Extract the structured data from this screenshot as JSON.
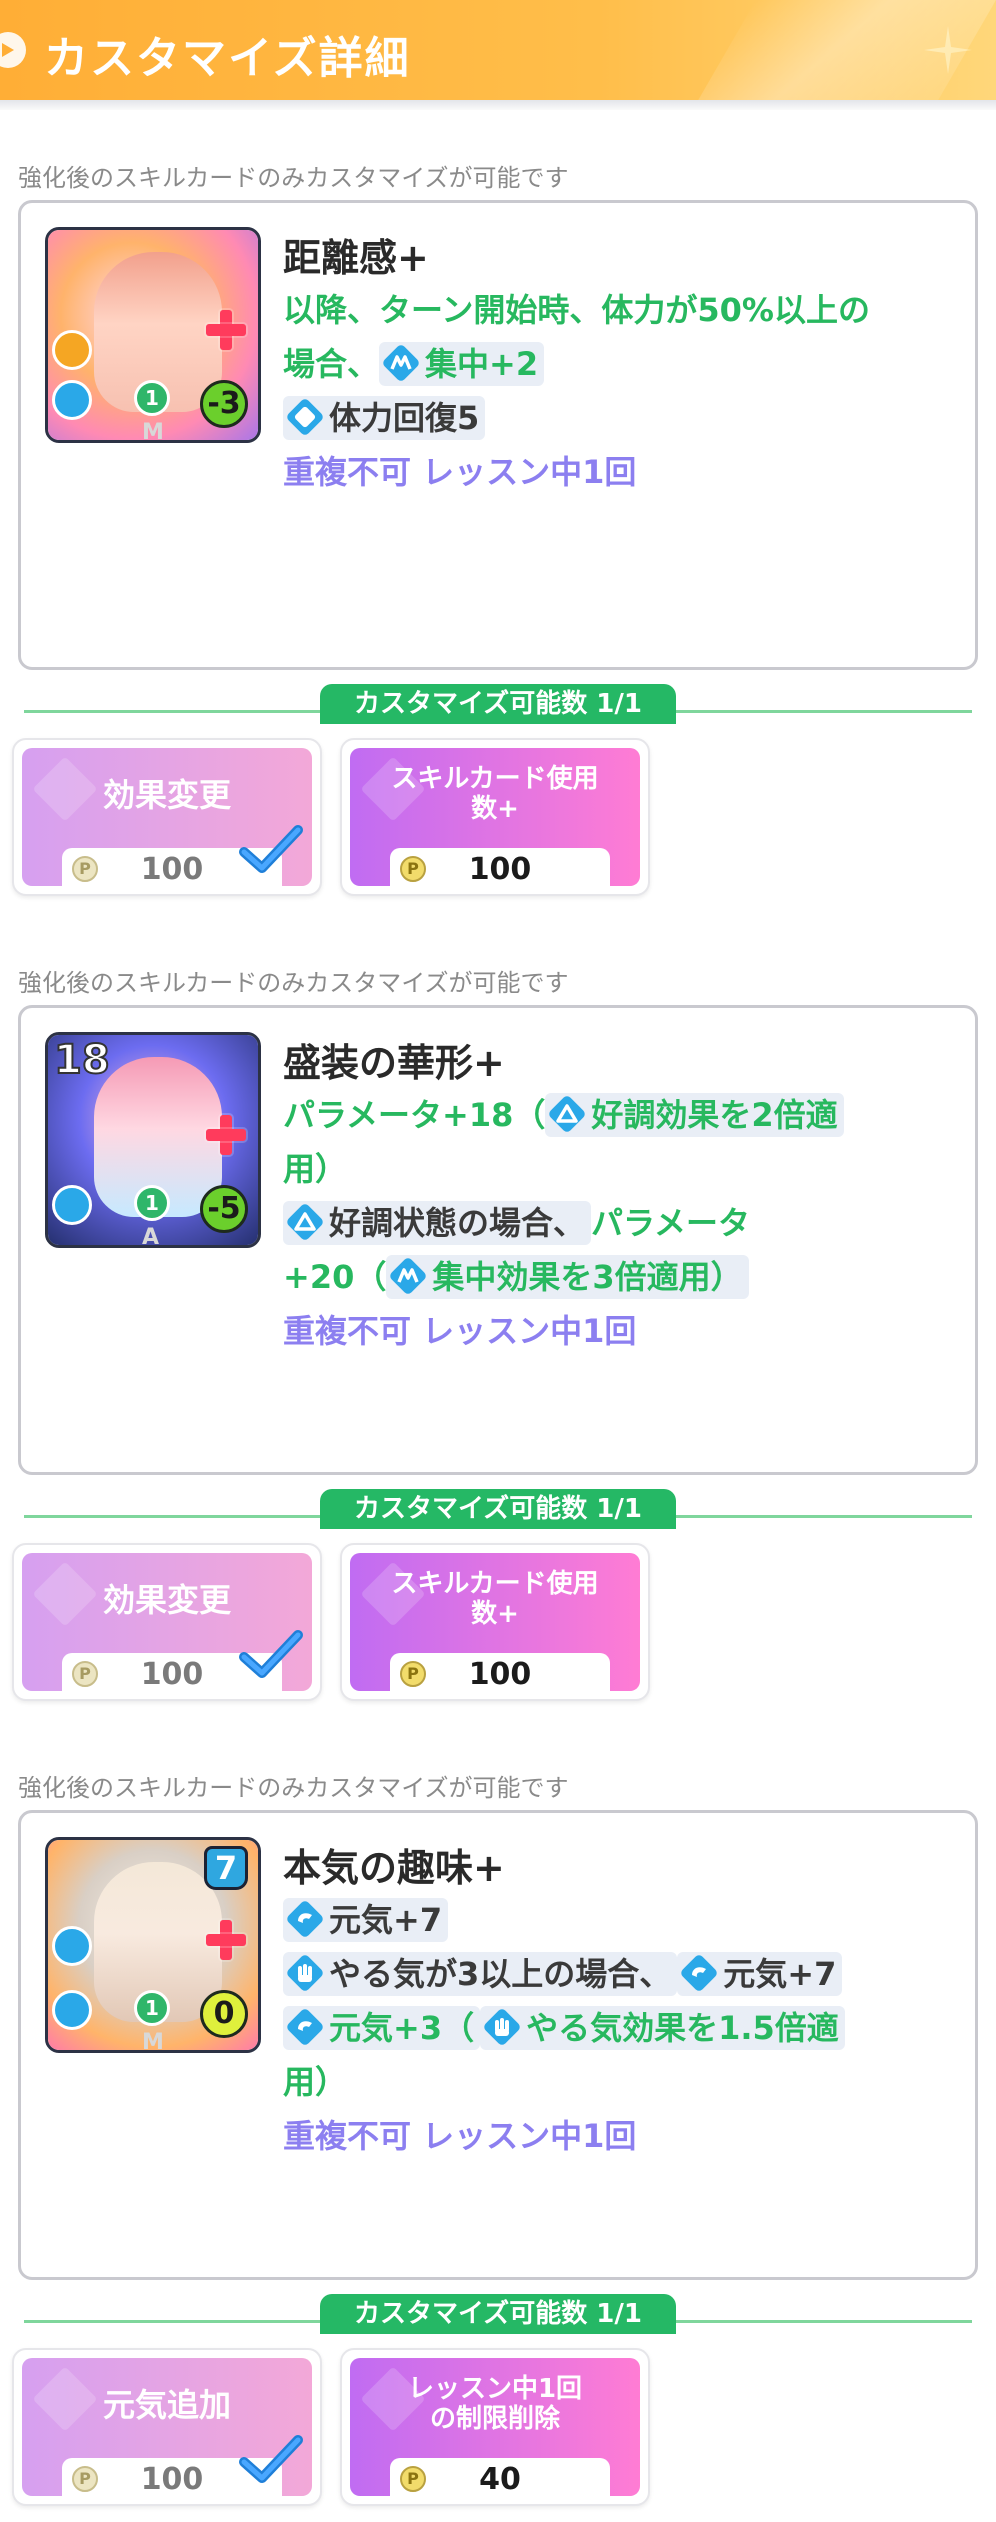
{
  "header": {
    "title": "カスタマイズ詳細"
  },
  "sections": [
    {
      "note": "強化後のスキルカードのみカスタマイズが可能です",
      "card": {
        "name": "距離感+",
        "cost_badge": "1",
        "value_badge": "-3",
        "letter": "M",
        "lines": [
          [
            {
              "t": "以降、ターン開始時、体力が50%以上の",
              "c": "green"
            }
          ],
          [
            {
              "t": "場合、",
              "c": "green"
            },
            {
              "icon": "concentration-icon",
              "t": "集中+2",
              "c": "green",
              "chip": true
            }
          ],
          [
            {
              "icon": "stamina-icon",
              "t": "体力回復5",
              "c": "dark",
              "chip": true
            }
          ],
          [
            {
              "t": "重複不可 レッスン中1回",
              "c": "purple"
            }
          ]
        ]
      },
      "customize_count": "カスタマイズ可能数 1/1",
      "options": [
        {
          "label": "効果変更",
          "cost": "100",
          "selected": true
        },
        {
          "label": "スキルカード使用数+",
          "label_lines": [
            "スキルカード使用",
            "数+"
          ],
          "cost": "100",
          "selected": false
        }
      ]
    },
    {
      "note": "強化後のスキルカードのみカスタマイズが可能です",
      "card": {
        "name": "盛装の華形+",
        "cost_badge": "1",
        "value_badge": "-5",
        "top_number": "18",
        "letter": "A",
        "lines": [
          [
            {
              "t": "パラメータ+18（",
              "c": "green"
            },
            {
              "icon": "good-condition-icon",
              "t": "好調効果を2倍適",
              "c": "green",
              "chip": true
            }
          ],
          [
            {
              "t": "用）",
              "c": "green"
            }
          ],
          [
            {
              "icon": "good-condition-icon",
              "t": "好調状態の場合、",
              "c": "dark",
              "chip": true
            },
            {
              "t": "パラメータ",
              "c": "green"
            }
          ],
          [
            {
              "t": "+20（",
              "c": "green"
            },
            {
              "icon": "concentration-icon",
              "t": "集中効果を3倍適用）",
              "c": "green",
              "chip": true
            }
          ],
          [
            {
              "t": "重複不可 レッスン中1回",
              "c": "purple"
            }
          ]
        ]
      },
      "customize_count": "カスタマイズ可能数 1/1",
      "options": [
        {
          "label": "効果変更",
          "cost": "100",
          "selected": true
        },
        {
          "label": "スキルカード使用数+",
          "label_lines": [
            "スキルカード使用",
            "数+"
          ],
          "cost": "100",
          "selected": false
        }
      ]
    },
    {
      "note": "強化後のスキルカードのみカスタマイズが可能です",
      "card": {
        "name": "本気の趣味+",
        "cost_badge": "1",
        "value_badge": "0",
        "top_right_number": "7",
        "letter": "M",
        "lines": [
          [
            {
              "icon": "energy-icon",
              "t": "元気+7",
              "c": "dark",
              "chip": true
            }
          ],
          [
            {
              "icon": "motivation-icon",
              "t": "やる気が3以上の場合、",
              "c": "dark",
              "chip": true
            },
            {
              "icon": "energy-icon",
              "t": "元気+7",
              "c": "dark",
              "chip": true
            }
          ],
          [
            {
              "icon": "energy-icon",
              "t": "元気+3（",
              "c": "green",
              "chip": true
            },
            {
              "icon": "motivation-icon",
              "t": "やる気効果を1.5倍適",
              "c": "green",
              "chip": true
            }
          ],
          [
            {
              "t": "用）",
              "c": "green"
            }
          ],
          [
            {
              "t": "重複不可 レッスン中1回",
              "c": "purple"
            }
          ]
        ]
      },
      "customize_count": "カスタマイズ可能数 1/1",
      "options": [
        {
          "label": "元気追加",
          "cost": "100",
          "selected": true
        },
        {
          "label": "レッスン中1回の制限削除",
          "label_lines": [
            "レッスン中1回",
            "の制限削除"
          ],
          "cost": "40",
          "selected": false
        }
      ]
    }
  ],
  "colors": {
    "header": "#ffae36",
    "green": "#27b85f",
    "purple": "#8c7ff0",
    "pill": "#25b865"
  }
}
